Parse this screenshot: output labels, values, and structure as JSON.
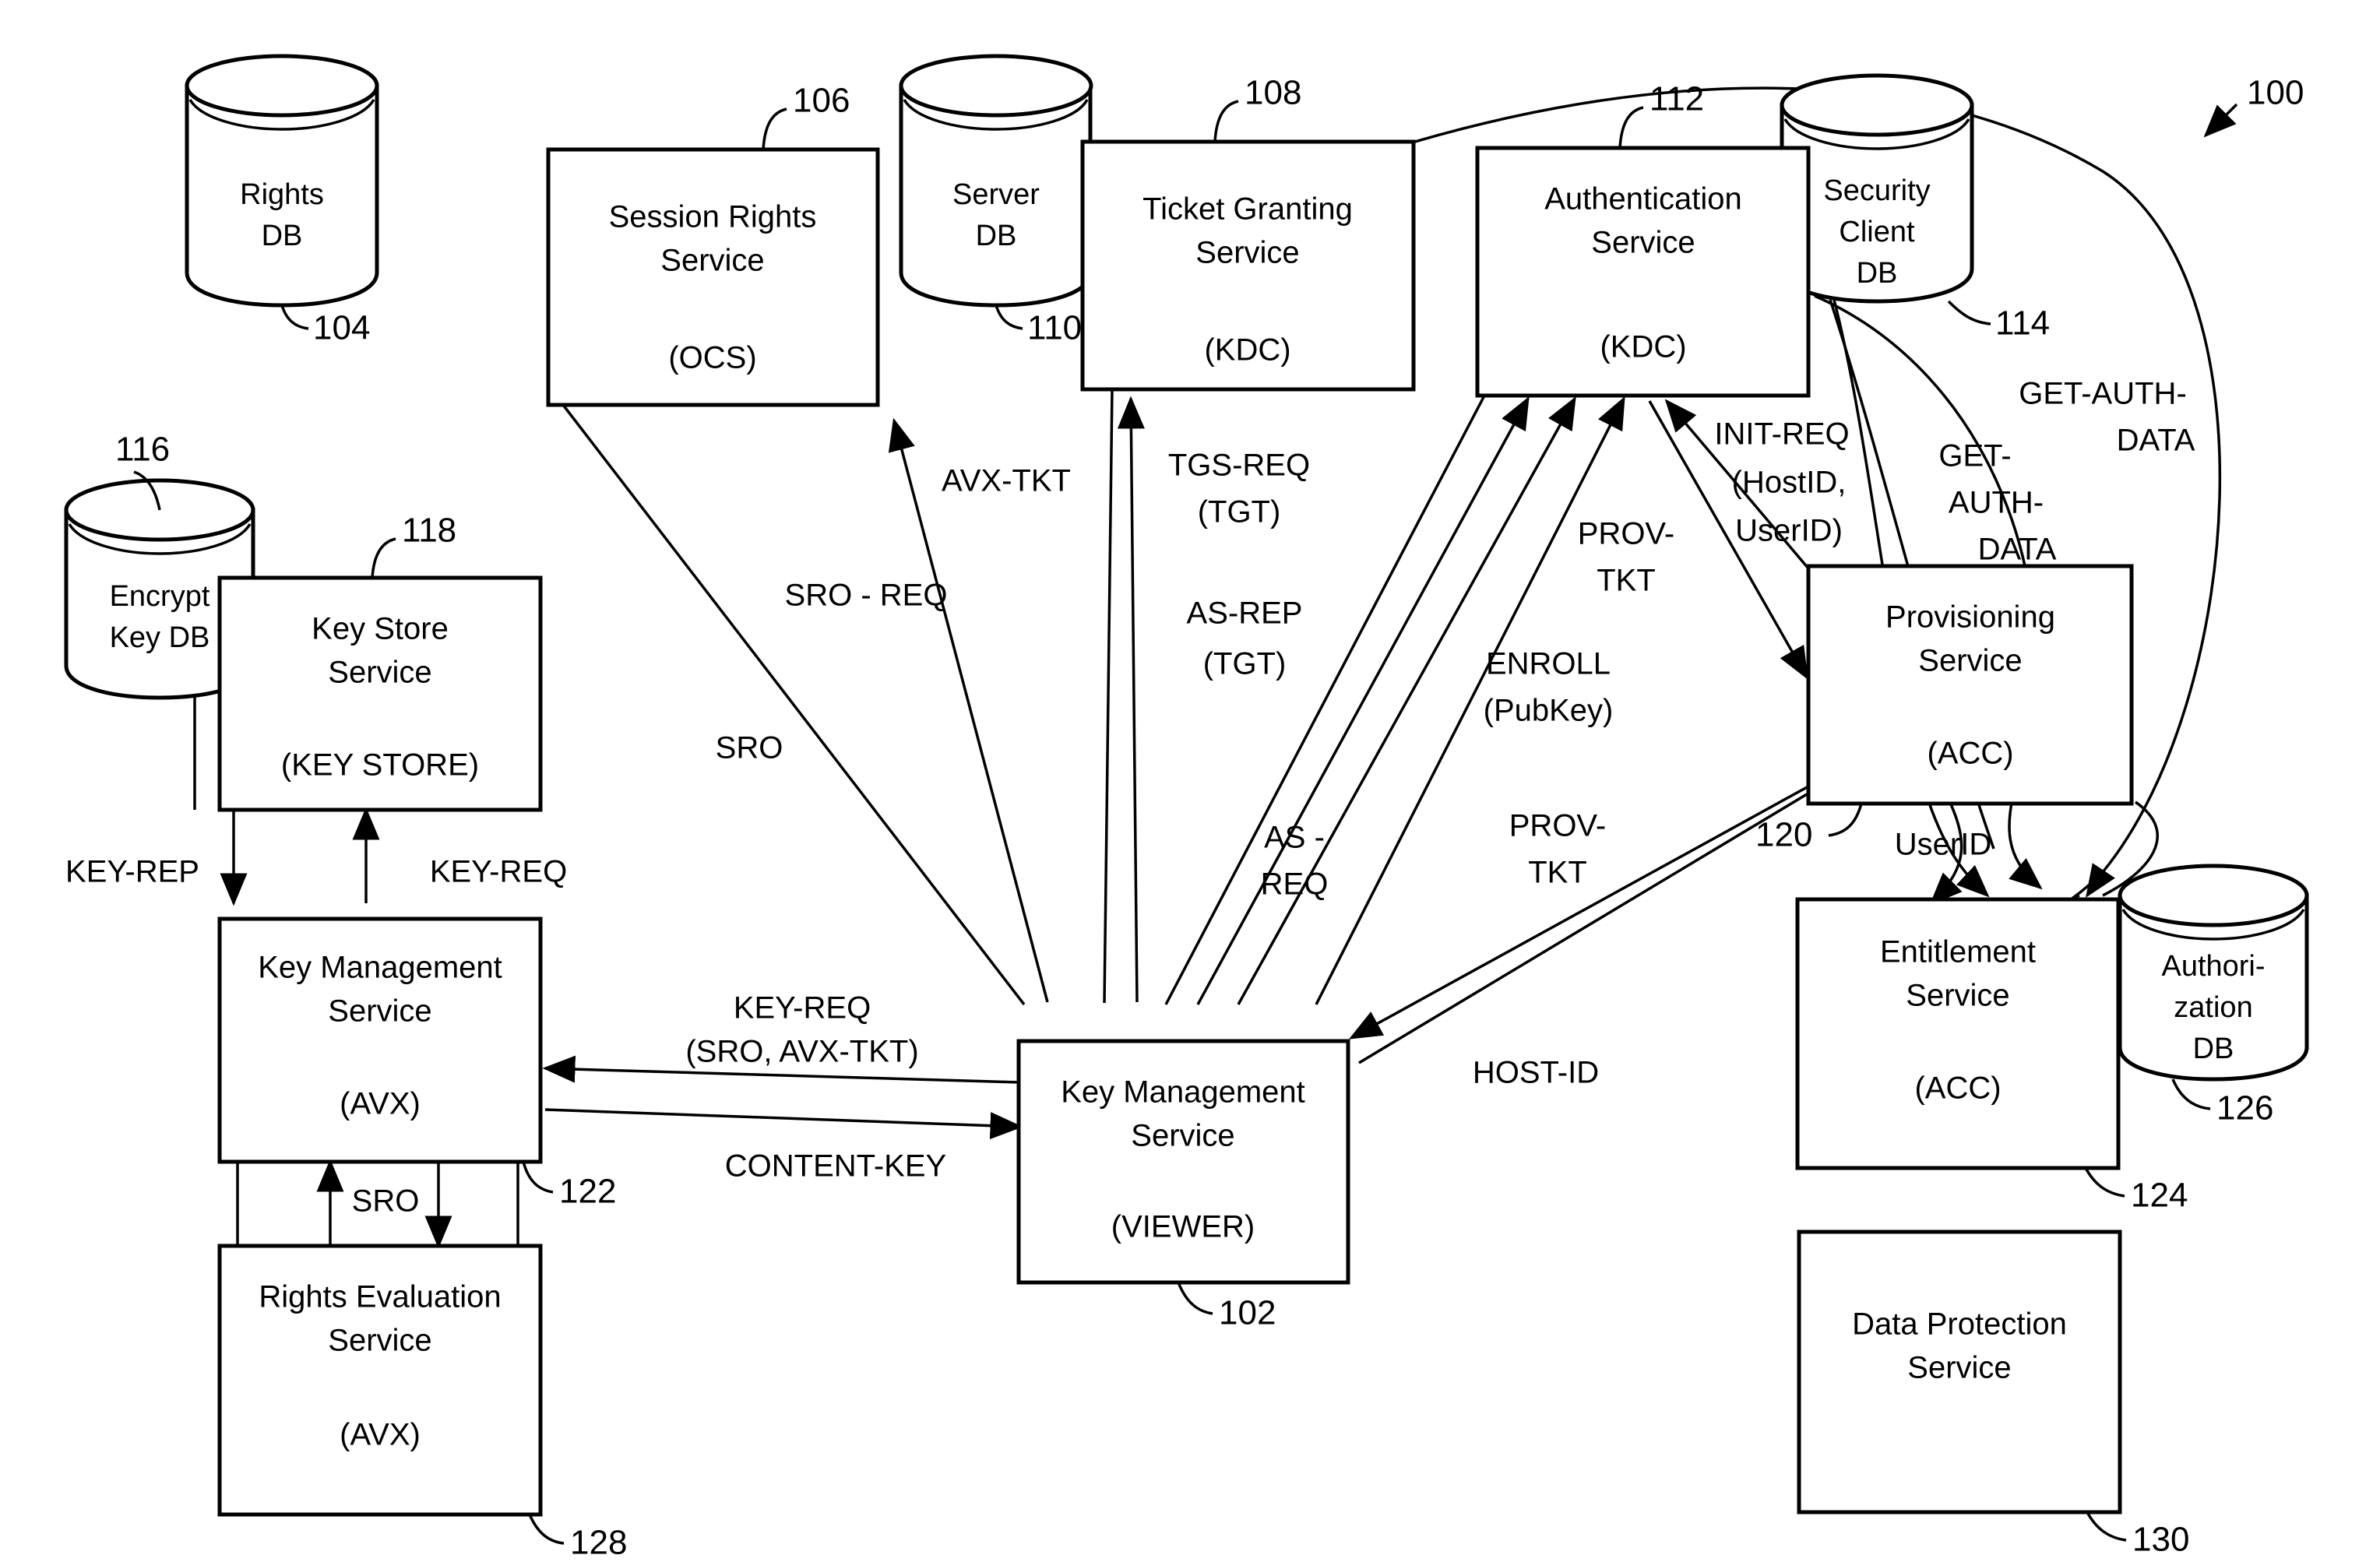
{
  "figure": {
    "reference_label": "100",
    "type": "patent-system-architecture-diagram"
  },
  "nodes": {
    "rights_db": {
      "label_line1": "Rights",
      "label_line2": "DB",
      "ref": "104"
    },
    "session_rights_service": {
      "title_line1": "Session Rights",
      "title_line2": "Service",
      "subtitle": "(OCS)",
      "ref": "106"
    },
    "server_db": {
      "label_line1": "Server",
      "label_line2": "DB",
      "ref": "110"
    },
    "ticket_granting_service": {
      "title_line1": "Ticket Granting",
      "title_line2": "Service",
      "subtitle": "(KDC)",
      "ref": "108"
    },
    "authentication_service": {
      "title_line1": "Authentication",
      "title_line2": "Service",
      "subtitle": "(KDC)",
      "ref": "112"
    },
    "security_client_db": {
      "label_line1": "Security",
      "label_line2": "Client",
      "label_line3": "DB",
      "ref": "114"
    },
    "encrypt_key_db": {
      "label_line1": "Encrypt",
      "label_line2": "Key DB",
      "ref": "116"
    },
    "key_store_service": {
      "title_line1": "Key Store",
      "title_line2": "Service",
      "subtitle": "(KEY STORE)",
      "ref": "118"
    },
    "key_management_service_avx": {
      "title_line1": "Key Management",
      "title_line2": "Service",
      "subtitle": "(AVX)",
      "ref": "122"
    },
    "rights_evaluation_service": {
      "title_line1": "Rights Evaluation",
      "title_line2": "Service",
      "subtitle": "(AVX)",
      "ref": "128"
    },
    "key_management_service_viewer": {
      "title_line1": "Key Management",
      "title_line2": "Service",
      "subtitle": "(VIEWER)",
      "ref": "102"
    },
    "provisioning_service": {
      "title_line1": "Provisioning",
      "title_line2": "Service",
      "subtitle": "(ACC)",
      "ref": "120"
    },
    "entitlement_service": {
      "title_line1": "Entitlement",
      "title_line2": "Service",
      "subtitle": "(ACC)",
      "ref": "124"
    },
    "authorization_db": {
      "label_line1": "Authori-",
      "label_line2": "zation",
      "label_line3": "DB",
      "ref": "126"
    },
    "data_protection_service": {
      "title_line1": "Data Protection",
      "title_line2": "Service",
      "subtitle": "",
      "ref": "130"
    }
  },
  "flows": {
    "avx_tkt": "AVX-TKT",
    "tgs_req": "TGS-REQ",
    "tgs_req_arg": "(TGT)",
    "sro_req": "SRO - REQ",
    "sro": "SRO",
    "as_rep": "AS-REP",
    "as_rep_arg": "(TGT)",
    "as_req_l1": "AS -",
    "as_req_l2": "REQ",
    "enroll_l1": "ENROLL",
    "enroll_l2": "(PubKey)",
    "prov_tkt_up_l1": "PROV-",
    "prov_tkt_up_l2": "TKT",
    "prov_tkt_dn_l1": "PROV-",
    "prov_tkt_dn_l2": "TKT",
    "init_req_l1": "INIT-REQ",
    "init_req_l2": "(HostID,",
    "init_req_l3": "UserID)",
    "get_auth_data_right_l1": "GET-AUTH-",
    "get_auth_data_right_l2": "DATA",
    "get_auth_data_mid_l1": "GET-",
    "get_auth_data_mid_l2": "AUTH-",
    "get_auth_data_mid_l3": "DATA",
    "key_rep": "KEY-REP",
    "key_req": "KEY-REQ",
    "key_req_sro_l1": "KEY-REQ",
    "key_req_sro_l2": "(SRO, AVX-TKT)",
    "content_key": "CONTENT-KEY",
    "sro_vertical": "SRO",
    "host_id": "HOST-ID",
    "user_id": "UserID"
  }
}
